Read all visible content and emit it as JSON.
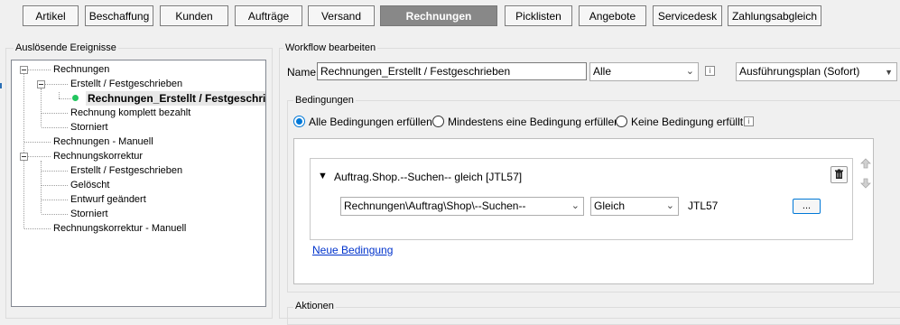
{
  "tabs": [
    {
      "label": "Artikel",
      "active": false
    },
    {
      "label": "Beschaffung",
      "active": false
    },
    {
      "label": "Kunden",
      "active": false
    },
    {
      "label": "Aufträge",
      "active": false
    },
    {
      "label": "Versand",
      "active": false
    },
    {
      "label": "Rechnungen",
      "active": true
    },
    {
      "label": "Picklisten",
      "active": false
    },
    {
      "label": "Angebote",
      "active": false
    },
    {
      "label": "Servicedesk",
      "active": false
    },
    {
      "label": "Zahlungsabgleich",
      "active": false
    }
  ],
  "events": {
    "title": "Auslösende Ereignisse",
    "nodes": [
      {
        "label": "Rechnungen"
      },
      {
        "label": "Erstellt / Festgeschrieben"
      },
      {
        "label": "Rechnungen_Erstellt / Festgeschri",
        "selected": true
      },
      {
        "label": "Rechnung komplett bezahlt"
      },
      {
        "label": "Storniert"
      },
      {
        "label": "Rechnungen - Manuell"
      },
      {
        "label": "Rechnungskorrektur"
      },
      {
        "label": "Erstellt / Festgeschrieben"
      },
      {
        "label": "Gelöscht"
      },
      {
        "label": "Entwurf geändert"
      },
      {
        "label": "Storniert"
      },
      {
        "label": "Rechnungskorrektur - Manuell"
      }
    ]
  },
  "workflow": {
    "title": "Workflow bearbeiten",
    "name_label": "Name",
    "name_value": "Rechnungen_Erstellt / Festgeschrieben",
    "scope_value": "Alle",
    "plan_value": "Ausführungsplan (Sofort)"
  },
  "conditions": {
    "title": "Bedingungen",
    "radios": [
      {
        "label": "Alle Bedingungen erfüllen",
        "checked": true
      },
      {
        "label": "Mindestens eine Bedingung erfüllen",
        "checked": false
      },
      {
        "label": "Keine Bedingung erfüllt",
        "checked": false
      }
    ],
    "item_header": "Auftrag.Shop.--Suchen-- gleich [JTL57]",
    "field_value": "Rechnungen\\Auftrag\\Shop\\--Suchen--",
    "operator_value": "Gleich",
    "value_text": "JTL57",
    "ellipsis_label": "...",
    "new_condition": "Neue Bedingung"
  },
  "actions": {
    "title": "Aktionen"
  },
  "icons": {
    "info": "info-icon",
    "delete": "trash-icon",
    "up": "arrow-up-icon",
    "down": "arrow-down-icon",
    "collapse": "triangle-down-icon",
    "chevron": "chevron-down-icon",
    "status": "green-dot-icon"
  },
  "colors": {
    "active_tab": "#888888",
    "accent": "#0078d7",
    "link": "#0033cc",
    "status": "#22c55e"
  }
}
